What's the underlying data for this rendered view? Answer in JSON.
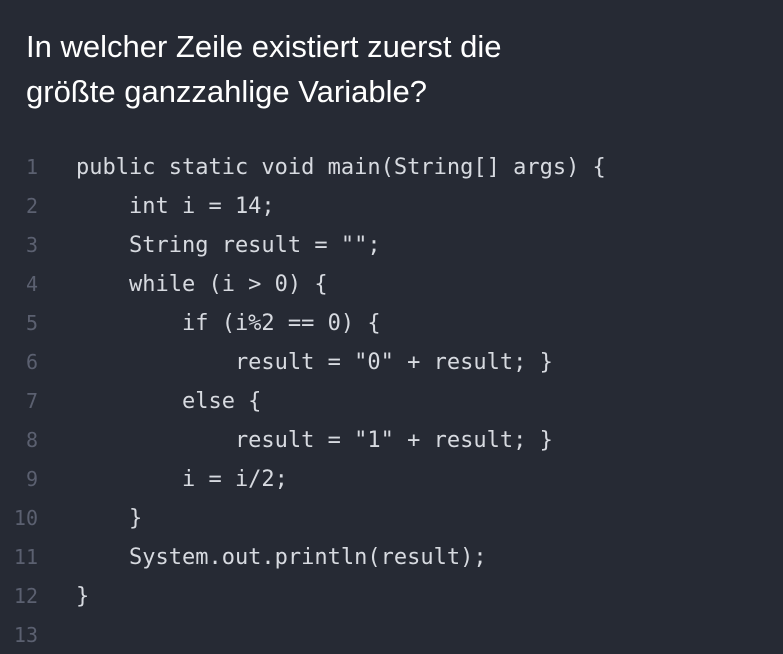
{
  "question": {
    "line1": "In welcher Zeile existiert zuerst die",
    "line2": "größte ganzzahlige Variable?"
  },
  "code": {
    "lines": [
      {
        "number": "1",
        "text": "public static void main(String[] args) {"
      },
      {
        "number": "2",
        "text": "    int i = 14;"
      },
      {
        "number": "3",
        "text": "    String result = \"\";"
      },
      {
        "number": "4",
        "text": "    while (i > 0) {"
      },
      {
        "number": "5",
        "text": "        if (i%2 == 0) {"
      },
      {
        "number": "6",
        "text": "            result = \"0\" + result; }"
      },
      {
        "number": "7",
        "text": "        else {"
      },
      {
        "number": "8",
        "text": "            result = \"1\" + result; }"
      },
      {
        "number": "9",
        "text": "        i = i/2;"
      },
      {
        "number": "10",
        "text": "    }"
      },
      {
        "number": "11",
        "text": "    System.out.println(result);"
      },
      {
        "number": "12",
        "text": "}"
      },
      {
        "number": "13",
        "text": ""
      }
    ]
  }
}
